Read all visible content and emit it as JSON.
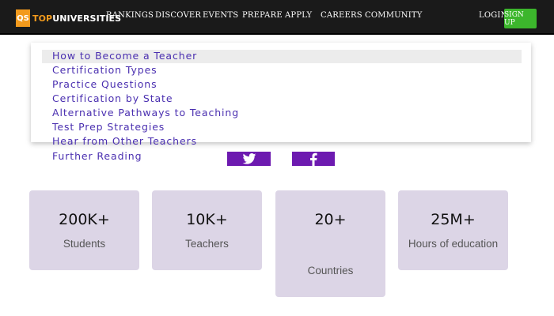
{
  "header": {
    "logo_badge": "QS",
    "logo_text_accent": "TOP",
    "logo_text_main": "UNIVERSITIES",
    "nav": [
      "RANKINGS",
      "DISCOVER",
      "EVENTS",
      "PREPARE",
      "APPLY",
      "CAREERS",
      "COMMUNITY"
    ],
    "login": "LOGIN",
    "signup": "SIGN UP"
  },
  "dropdown": {
    "items": [
      "How to Become a Teacher",
      "Certification Types",
      "Practice Questions",
      "Certification by State",
      "Alternative Pathways to Teaching",
      "Test Prep Strategies",
      "Hear from Other Teachers"
    ]
  },
  "further_reading": "Further Reading",
  "social": {
    "twitter_icon": "twitter-icon",
    "facebook_icon": "facebook-icon"
  },
  "stats": [
    {
      "value": "200K+",
      "label": "Students"
    },
    {
      "value": "10K+",
      "label": "Teachers"
    },
    {
      "value": "20+",
      "label": "Countries"
    },
    {
      "value": "25M+",
      "label": "Hours of education"
    }
  ],
  "colors": {
    "topbar": "#1a1a1a",
    "brand_orange": "#f29a1d",
    "signup_green": "#3cb62c",
    "menu_link": "#4a2fb0",
    "social_purple": "#6d1ab0",
    "card_bg": "#dcd5e6"
  }
}
